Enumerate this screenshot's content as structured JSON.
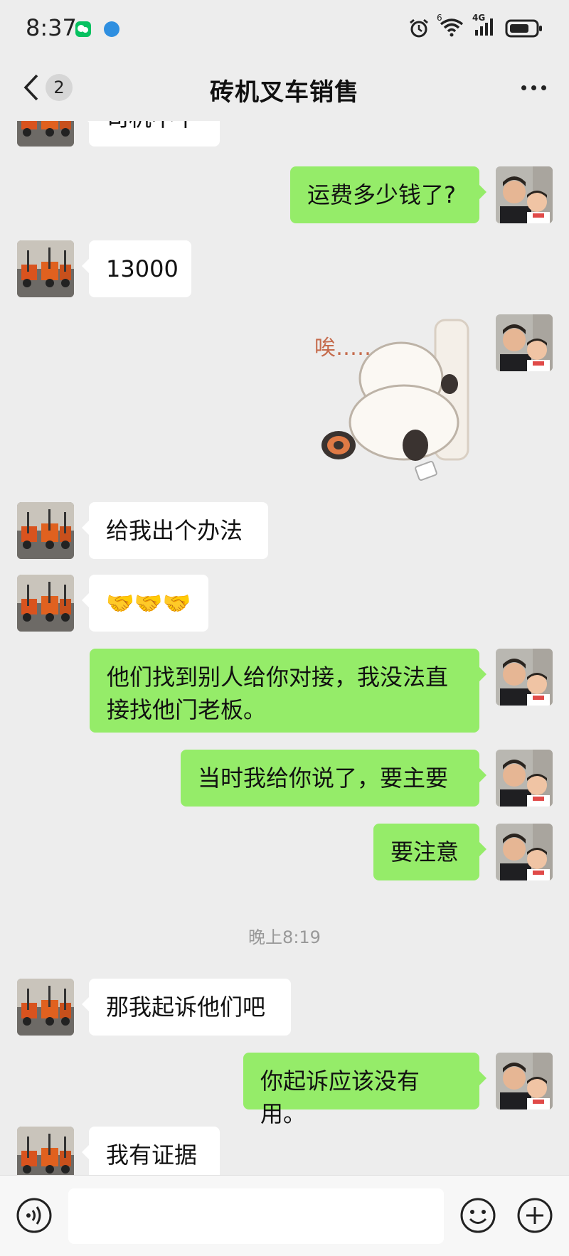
{
  "status_bar": {
    "time": "8:37",
    "network": "4G",
    "sim_index": "6"
  },
  "nav": {
    "title": "砖机叉车销售",
    "unread_count": "2"
  },
  "messages": [
    {
      "side": "left",
      "type": "text",
      "text": "司机不干"
    },
    {
      "side": "right",
      "type": "text",
      "text": "运费多少钱了?"
    },
    {
      "side": "left",
      "type": "text",
      "text": "13000"
    },
    {
      "side": "right",
      "type": "sticker",
      "text": "唉……"
    },
    {
      "side": "left",
      "type": "text",
      "text": "给我出个办法"
    },
    {
      "side": "left",
      "type": "text",
      "text": "🤝🤝🤝"
    },
    {
      "side": "right",
      "type": "text",
      "text": "他们找到别人给你对接，我没法直接找他门老板。"
    },
    {
      "side": "right",
      "type": "text",
      "text": "当时我给你说了，要主要"
    },
    {
      "side": "right",
      "type": "text",
      "text": "要注意"
    },
    {
      "side": "left",
      "type": "text",
      "text": "那我起诉他们吧"
    },
    {
      "side": "right",
      "type": "text",
      "text": "你起诉应该没有用。"
    },
    {
      "side": "left",
      "type": "text",
      "text": "我有证据"
    }
  ],
  "timestamp": "晚上8:19",
  "colors": {
    "chat_background": "#ededed",
    "incoming_bubble": "#ffffff",
    "outgoing_bubble": "#95ec69",
    "wechat_green": "#07c160"
  },
  "icons": [
    "voice-icon",
    "emoji-icon",
    "plus-icon",
    "back-chevron-icon",
    "more-icon"
  ]
}
